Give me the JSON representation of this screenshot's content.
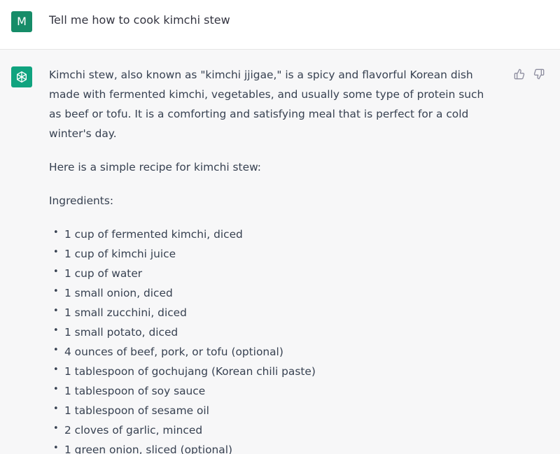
{
  "user": {
    "avatar_letter": "M",
    "message": "Tell me how to cook kimchi stew"
  },
  "assistant": {
    "intro": "Kimchi stew, also known as \"kimchi jjigae,\" is a spicy and flavorful Korean dish made with fermented kimchi, vegetables, and usually some type of protein such as beef or tofu. It is a comforting and satisfying meal that is perfect for a cold winter's day.",
    "recipe_intro": "Here is a simple recipe for kimchi stew:",
    "ingredients_heading": "Ingredients:",
    "ingredients": [
      "1 cup of fermented kimchi, diced",
      "1 cup of kimchi juice",
      "1 cup of water",
      "1 small onion, diced",
      "1 small zucchini, diced",
      "1 small potato, diced",
      "4 ounces of beef, pork, or tofu (optional)",
      "1 tablespoon of gochujang (Korean chili paste)",
      "1 tablespoon of soy sauce",
      "1 tablespoon of sesame oil",
      "2 cloves of garlic, minced",
      "1 green onion, sliced (optional)"
    ],
    "bullet": "•"
  },
  "icons": {
    "bot_avatar": "openai-logo-icon",
    "thumbs_up": "thumbs-up-icon",
    "thumbs_down": "thumbs-down-icon"
  },
  "colors": {
    "user_avatar_bg": "#168c68",
    "bot_avatar_bg": "#10a37f",
    "assistant_bg": "#f7f7f8"
  }
}
